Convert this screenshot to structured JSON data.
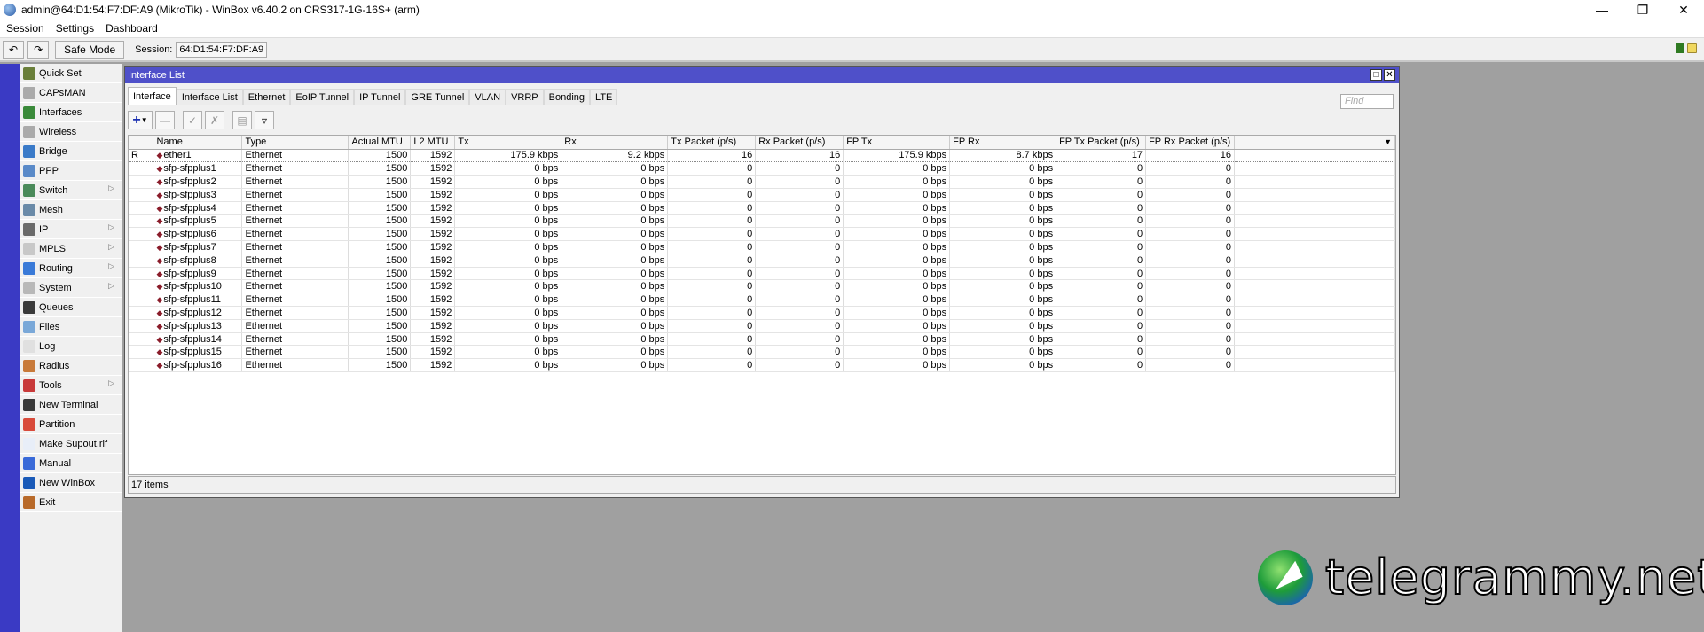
{
  "app": {
    "title": "admin@64:D1:54:F7:DF:A9 (MikroTik) - WinBox v6.40.2 on CRS317-1G-16S+ (arm)"
  },
  "menu": [
    "Session",
    "Settings",
    "Dashboard"
  ],
  "toolbar": {
    "safe_mode": "Safe Mode",
    "session_label": "Session:",
    "session_value": "64:D1:54:F7:DF:A9"
  },
  "sidebar": [
    {
      "label": "Quick Set",
      "color": "#6a7f3a"
    },
    {
      "label": "CAPsMAN",
      "color": "#aaa"
    },
    {
      "label": "Interfaces",
      "color": "#3a8a3a"
    },
    {
      "label": "Wireless",
      "color": "#aaa"
    },
    {
      "label": "Bridge",
      "color": "#3a7ac8"
    },
    {
      "label": "PPP",
      "color": "#5a8ac8"
    },
    {
      "label": "Switch",
      "color": "#4a8a5a",
      "sub": true
    },
    {
      "label": "Mesh",
      "color": "#6a8aa8"
    },
    {
      "label": "IP",
      "color": "#6a6a6a",
      "sub": true
    },
    {
      "label": "MPLS",
      "color": "#c8c8c8",
      "sub": true
    },
    {
      "label": "Routing",
      "color": "#3a7ad8",
      "sub": true
    },
    {
      "label": "System",
      "color": "#b8b8b8",
      "sub": true
    },
    {
      "label": "Queues",
      "color": "#3a3a3a"
    },
    {
      "label": "Files",
      "color": "#7aa8d8"
    },
    {
      "label": "Log",
      "color": "#e0e0e0"
    },
    {
      "label": "Radius",
      "color": "#c87a3a"
    },
    {
      "label": "Tools",
      "color": "#c83a3a",
      "sub": true
    },
    {
      "label": "New Terminal",
      "color": "#3a3a3a"
    },
    {
      "label": "Partition",
      "color": "#d84a3a"
    },
    {
      "label": "Make Supout.rif",
      "color": "#e8eef8"
    },
    {
      "label": "Manual",
      "color": "#3a6ad8"
    },
    {
      "label": "New WinBox",
      "color": "#1a5ab8"
    },
    {
      "label": "Exit",
      "color": "#b86a2a"
    }
  ],
  "window": {
    "title": "Interface List",
    "tabs": [
      "Interface",
      "Interface List",
      "Ethernet",
      "EoIP Tunnel",
      "IP Tunnel",
      "GRE Tunnel",
      "VLAN",
      "VRRP",
      "Bonding",
      "LTE"
    ],
    "active_tab": "Interface",
    "find_placeholder": "Find",
    "columns": [
      "",
      "Name",
      "Type",
      "Actual MTU",
      "L2 MTU",
      "Tx",
      "Rx",
      "Tx Packet (p/s)",
      "Rx Packet (p/s)",
      "FP Tx",
      "FP Rx",
      "FP Tx Packet (p/s)",
      "FP Rx Packet (p/s)"
    ],
    "rows": [
      [
        "R",
        "ether1",
        "Ethernet",
        "1500",
        "1592",
        "175.9 kbps",
        "9.2 kbps",
        "16",
        "16",
        "175.9 kbps",
        "8.7 kbps",
        "17",
        "16"
      ],
      [
        "",
        "sfp-sfpplus1",
        "Ethernet",
        "1500",
        "1592",
        "0 bps",
        "0 bps",
        "0",
        "0",
        "0 bps",
        "0 bps",
        "0",
        "0"
      ],
      [
        "",
        "sfp-sfpplus2",
        "Ethernet",
        "1500",
        "1592",
        "0 bps",
        "0 bps",
        "0",
        "0",
        "0 bps",
        "0 bps",
        "0",
        "0"
      ],
      [
        "",
        "sfp-sfpplus3",
        "Ethernet",
        "1500",
        "1592",
        "0 bps",
        "0 bps",
        "0",
        "0",
        "0 bps",
        "0 bps",
        "0",
        "0"
      ],
      [
        "",
        "sfp-sfpplus4",
        "Ethernet",
        "1500",
        "1592",
        "0 bps",
        "0 bps",
        "0",
        "0",
        "0 bps",
        "0 bps",
        "0",
        "0"
      ],
      [
        "",
        "sfp-sfpplus5",
        "Ethernet",
        "1500",
        "1592",
        "0 bps",
        "0 bps",
        "0",
        "0",
        "0 bps",
        "0 bps",
        "0",
        "0"
      ],
      [
        "",
        "sfp-sfpplus6",
        "Ethernet",
        "1500",
        "1592",
        "0 bps",
        "0 bps",
        "0",
        "0",
        "0 bps",
        "0 bps",
        "0",
        "0"
      ],
      [
        "",
        "sfp-sfpplus7",
        "Ethernet",
        "1500",
        "1592",
        "0 bps",
        "0 bps",
        "0",
        "0",
        "0 bps",
        "0 bps",
        "0",
        "0"
      ],
      [
        "",
        "sfp-sfpplus8",
        "Ethernet",
        "1500",
        "1592",
        "0 bps",
        "0 bps",
        "0",
        "0",
        "0 bps",
        "0 bps",
        "0",
        "0"
      ],
      [
        "",
        "sfp-sfpplus9",
        "Ethernet",
        "1500",
        "1592",
        "0 bps",
        "0 bps",
        "0",
        "0",
        "0 bps",
        "0 bps",
        "0",
        "0"
      ],
      [
        "",
        "sfp-sfpplus10",
        "Ethernet",
        "1500",
        "1592",
        "0 bps",
        "0 bps",
        "0",
        "0",
        "0 bps",
        "0 bps",
        "0",
        "0"
      ],
      [
        "",
        "sfp-sfpplus11",
        "Ethernet",
        "1500",
        "1592",
        "0 bps",
        "0 bps",
        "0",
        "0",
        "0 bps",
        "0 bps",
        "0",
        "0"
      ],
      [
        "",
        "sfp-sfpplus12",
        "Ethernet",
        "1500",
        "1592",
        "0 bps",
        "0 bps",
        "0",
        "0",
        "0 bps",
        "0 bps",
        "0",
        "0"
      ],
      [
        "",
        "sfp-sfpplus13",
        "Ethernet",
        "1500",
        "1592",
        "0 bps",
        "0 bps",
        "0",
        "0",
        "0 bps",
        "0 bps",
        "0",
        "0"
      ],
      [
        "",
        "sfp-sfpplus14",
        "Ethernet",
        "1500",
        "1592",
        "0 bps",
        "0 bps",
        "0",
        "0",
        "0 bps",
        "0 bps",
        "0",
        "0"
      ],
      [
        "",
        "sfp-sfpplus15",
        "Ethernet",
        "1500",
        "1592",
        "0 bps",
        "0 bps",
        "0",
        "0",
        "0 bps",
        "0 bps",
        "0",
        "0"
      ],
      [
        "",
        "sfp-sfpplus16",
        "Ethernet",
        "1500",
        "1592",
        "0 bps",
        "0 bps",
        "0",
        "0",
        "0 bps",
        "0 bps",
        "0",
        "0"
      ]
    ],
    "status": "17 items"
  },
  "watermark": "telegrammy.net"
}
